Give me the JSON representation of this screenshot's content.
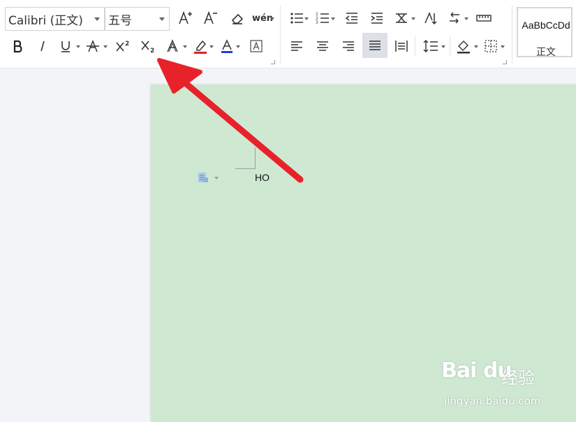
{
  "toolbar": {
    "font_name": "Calibri (正文)",
    "font_size": "五号",
    "phonetic_label": "wén",
    "style": {
      "sample": "AaBbCcDd",
      "name": "正文"
    }
  },
  "document": {
    "text": "HO"
  },
  "watermark": {
    "brand": "Bai du",
    "suffix": "经验",
    "url": "jingyan.baidu.com"
  },
  "colors": {
    "page_background": "#cee8d2",
    "highlight": "#e02020",
    "font_color": "#1f3fdc",
    "annotation_arrow": "#e8222a"
  }
}
